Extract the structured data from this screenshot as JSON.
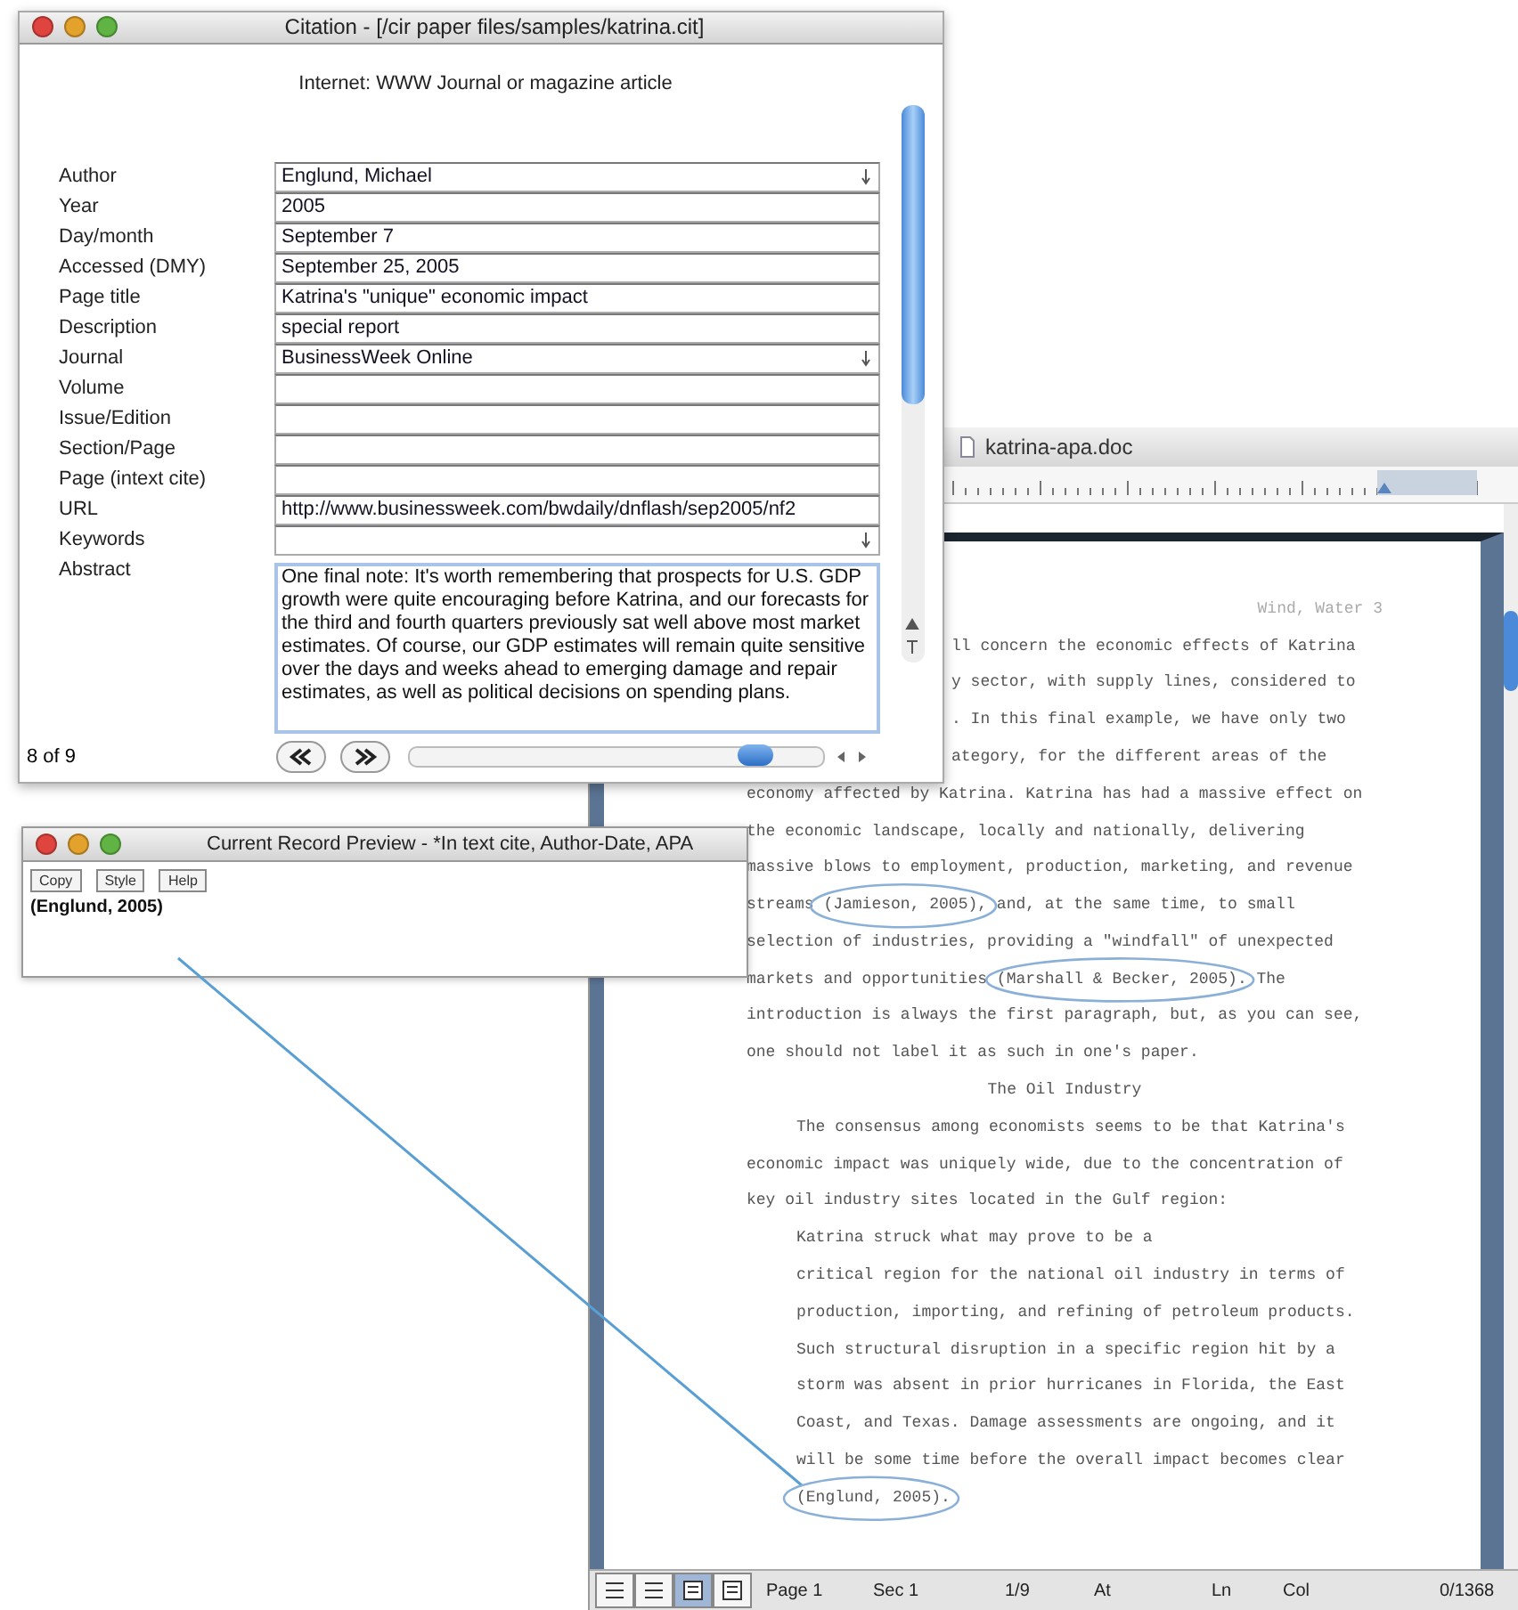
{
  "document_window": {
    "title": "katrina-apa.doc",
    "header": "Wind, Water 3",
    "lines": [
      {
        "kind": "cut",
        "text": "ll concern the economic effects of Katrina"
      },
      {
        "kind": "cut",
        "text": "y sector, with supply lines, considered to"
      },
      {
        "kind": "cut",
        "text": ". In this final example, we have only two"
      },
      {
        "kind": "cut",
        "text": "ategory, for the different areas of the"
      },
      {
        "kind": "body",
        "text": "economy affected by Katrina. Katrina has had a massive effect on"
      },
      {
        "kind": "body",
        "text": "the economic landscape, locally and nationally, delivering"
      },
      {
        "kind": "body",
        "text": "massive blows to employment, production, marketing, and revenue"
      },
      {
        "kind": "body",
        "text": "streams (Jamieson, 2005), and, at the same time, to small"
      },
      {
        "kind": "body",
        "text": "selection of industries, providing a \"windfall\" of unexpected"
      },
      {
        "kind": "body",
        "text": "markets and opportunities (Marshall & Becker, 2005). The"
      },
      {
        "kind": "body",
        "text": "introduction is always the first paragraph, but, as you can see,"
      },
      {
        "kind": "body",
        "text": "one should not label it as such in one's paper."
      },
      {
        "kind": "heading",
        "text": "The Oil Industry"
      },
      {
        "kind": "indent",
        "text": "The consensus among economists seems to be that Katrina's"
      },
      {
        "kind": "body",
        "text": "economic impact was uniquely wide, due to the concentration of"
      },
      {
        "kind": "body",
        "text": "key oil industry sites located in the Gulf region:"
      },
      {
        "kind": "quote",
        "text": "Katrina struck what may prove to be a"
      },
      {
        "kind": "quote",
        "text": "critical region for the national oil industry in terms of"
      },
      {
        "kind": "quote",
        "text": "production, importing, and refining of petroleum products."
      },
      {
        "kind": "quote",
        "text": "Such structural disruption in a specific region hit by a"
      },
      {
        "kind": "quote",
        "text": "storm was absent in prior hurricanes in Florida, the East"
      },
      {
        "kind": "quote",
        "text": "Coast, and Texas. Damage assessments are ongoing, and it"
      },
      {
        "kind": "quote",
        "text": "will be some time before the overall impact becomes clear"
      },
      {
        "kind": "quote",
        "text": "(Englund, 2005)."
      }
    ],
    "status_bar": [
      "Page 1",
      "Sec 1",
      "1/9",
      "At",
      "Ln",
      "Col",
      "0/1368"
    ]
  },
  "citation_window": {
    "title": "Citation - [/cir paper files/samples/katrina.cit]",
    "record_type": "Internet: WWW Journal or magazine article",
    "fields": [
      {
        "label": "Author",
        "value": "Englund, Michael",
        "kind": "list"
      },
      {
        "label": "Year",
        "value": "2005",
        "kind": "text"
      },
      {
        "label": "Day/month",
        "value": "September 7",
        "kind": "text"
      },
      {
        "label": "Accessed (DMY)",
        "value": "September 25, 2005",
        "kind": "text"
      },
      {
        "label": "Page title",
        "value": "Katrina's \"unique\" economic impact",
        "kind": "text"
      },
      {
        "label": "Description",
        "value": "special report",
        "kind": "text"
      },
      {
        "label": "Journal",
        "value": "BusinessWeek Online",
        "kind": "list"
      },
      {
        "label": "Volume",
        "kind": "text"
      },
      {
        "label": "Issue/Edition",
        "kind": "text"
      },
      {
        "label": "Section/Page",
        "kind": "text"
      },
      {
        "label": "Page (intext cite)",
        "kind": "text"
      },
      {
        "label": "URL",
        "value": "http://www.businessweek.com/bwdaily/dnflash/sep2005/nf2",
        "kind": "text"
      },
      {
        "label": "Keywords",
        "kind": "list"
      }
    ],
    "abstract": {
      "label": "Abstract",
      "value": "One final note: It's worth remembering that prospects for U.S. GDP growth were quite encouraging before Katrina, and our forecasts for the third and fourth quarters previously sat well above most market estimates. Of course, our GDP estimates will remain quite sensitive over the days and weeks ahead to emerging damage and repair estimates, as well as political decisions on spending plans."
    },
    "record_counter": "8 of 9",
    "record_slider": {
      "level": 0.87
    }
  },
  "preview_window": {
    "title": "Current Record Preview - *In text cite, Author-Date, APA",
    "buttons": [
      "Copy",
      "Style",
      "Help"
    ],
    "citation": "(Englund, 2005)"
  }
}
